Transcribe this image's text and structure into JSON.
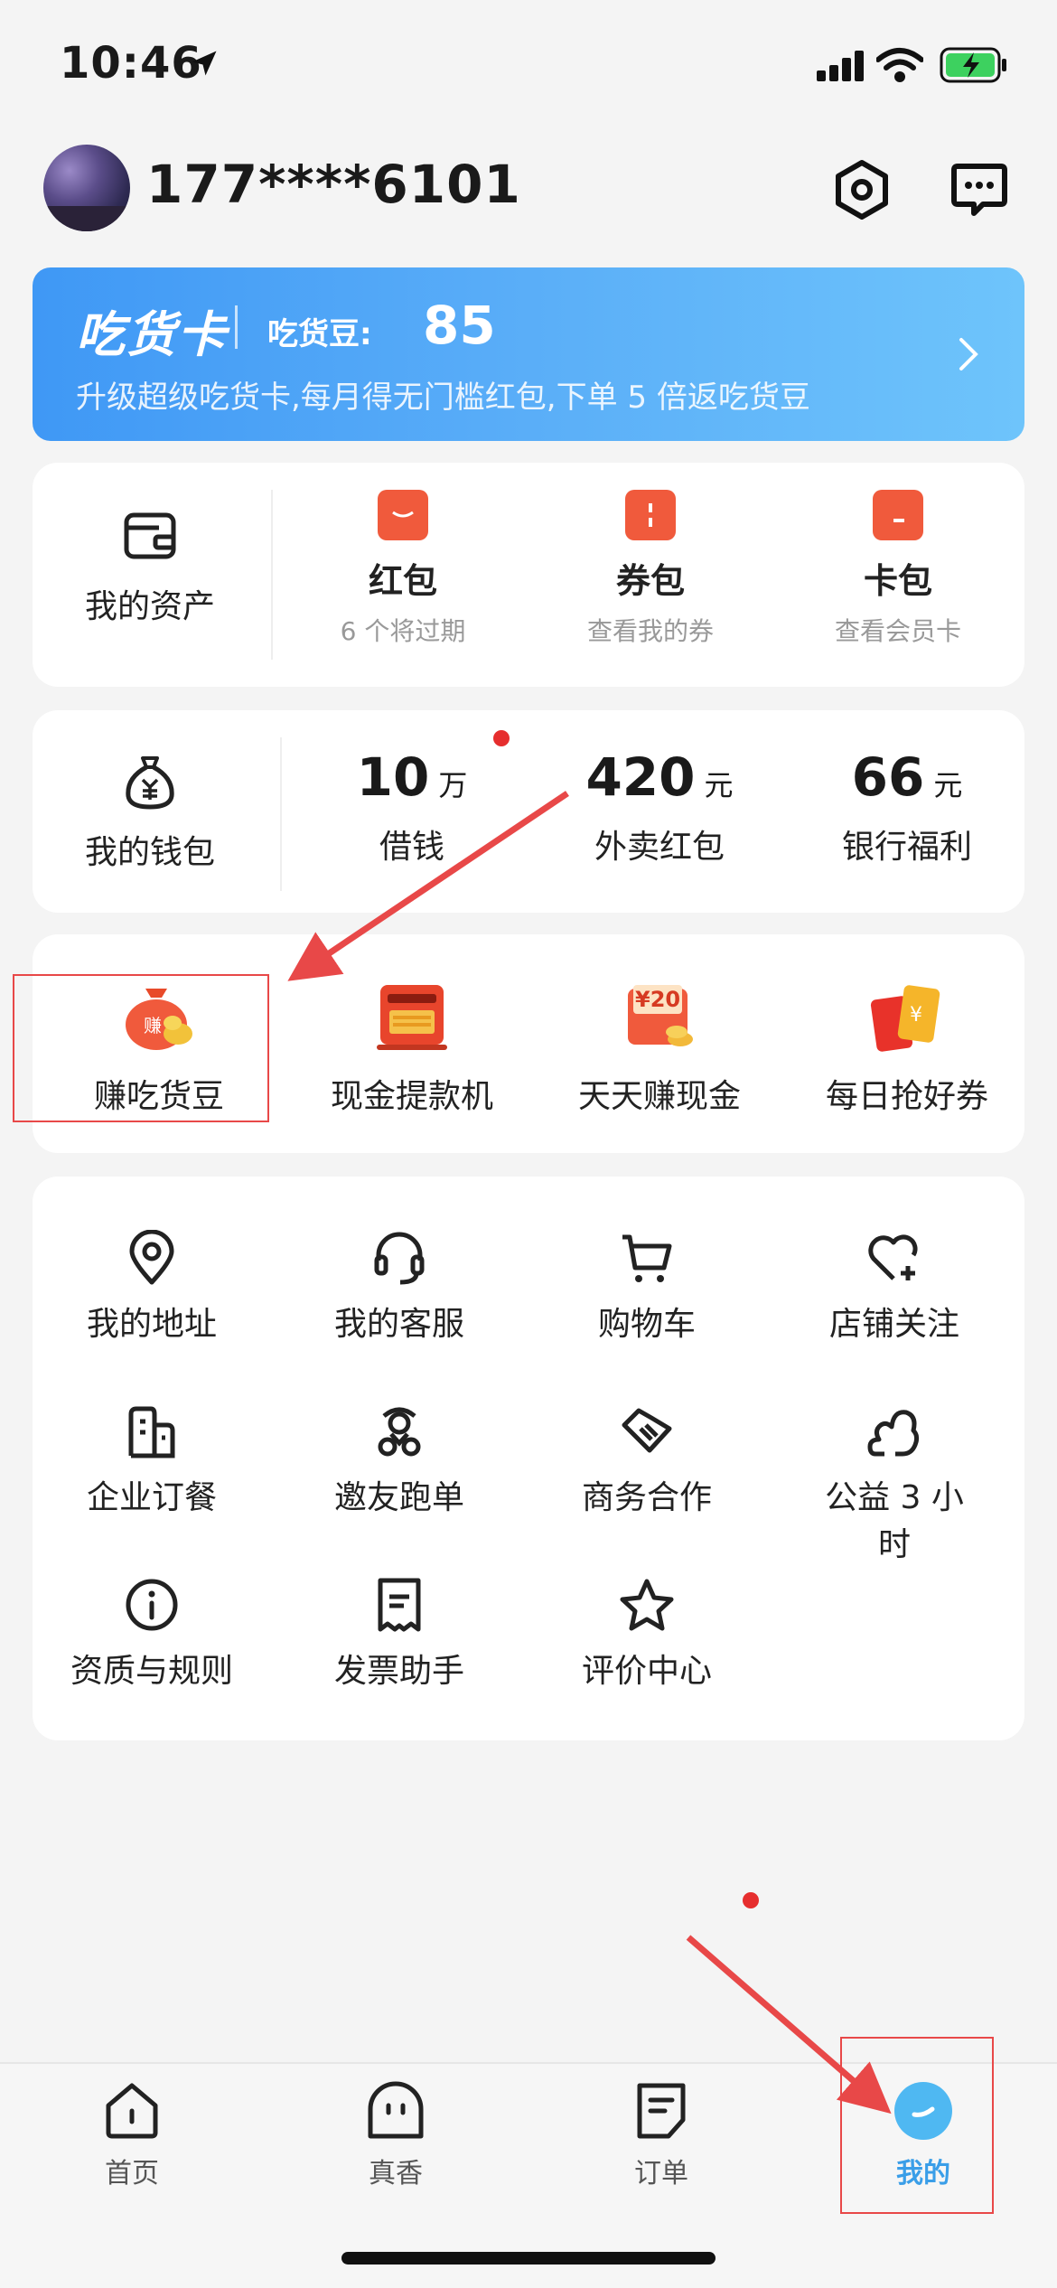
{
  "status": {
    "time": "10:46"
  },
  "header": {
    "phone": "177****6101"
  },
  "food_card": {
    "brand": "吃货卡",
    "bean_label": "吃货豆:",
    "bean_value": "85",
    "desc": "升级超级吃货卡,每月得无门槛红包,下单 5 倍返吃货豆"
  },
  "assets": {
    "title": "我的资产",
    "items": [
      {
        "label": "红包",
        "sub": "6 个将过期"
      },
      {
        "label": "券包",
        "sub": "查看我的券"
      },
      {
        "label": "卡包",
        "sub": "查看会员卡"
      }
    ]
  },
  "wallet": {
    "title": "我的钱包",
    "items": [
      {
        "num": "10",
        "unit": "万",
        "label": "借钱"
      },
      {
        "num": "420",
        "unit": "元",
        "label": "外卖红包"
      },
      {
        "num": "66",
        "unit": "元",
        "label": "银行福利"
      }
    ]
  },
  "promos": [
    {
      "label": "赚吃货豆"
    },
    {
      "label": "现金提款机"
    },
    {
      "label": "天天赚现金",
      "badge": "¥20"
    },
    {
      "label": "每日抢好券"
    }
  ],
  "services": [
    {
      "label": "我的地址",
      "icon": "location-icon"
    },
    {
      "label": "我的客服",
      "icon": "headset-icon"
    },
    {
      "label": "购物车",
      "icon": "cart-icon"
    },
    {
      "label": "店铺关注",
      "icon": "heart-plus-icon"
    },
    {
      "label": "企业订餐",
      "icon": "building-icon"
    },
    {
      "label": "邀友跑单",
      "icon": "rider-icon"
    },
    {
      "label": "商务合作",
      "icon": "handshake-icon"
    },
    {
      "label": "公益 3 小时",
      "icon": "charity-icon"
    },
    {
      "label": "资质与规则",
      "icon": "info-icon"
    },
    {
      "label": "发票助手",
      "icon": "invoice-icon"
    },
    {
      "label": "评价中心",
      "icon": "star-icon"
    }
  ],
  "tabs": [
    {
      "label": "首页"
    },
    {
      "label": "真香"
    },
    {
      "label": "订单"
    },
    {
      "label": "我的"
    }
  ],
  "colors": {
    "accent": "#3a9ee8",
    "annotation": "#e84848",
    "promo_red": "#f05a3c"
  }
}
